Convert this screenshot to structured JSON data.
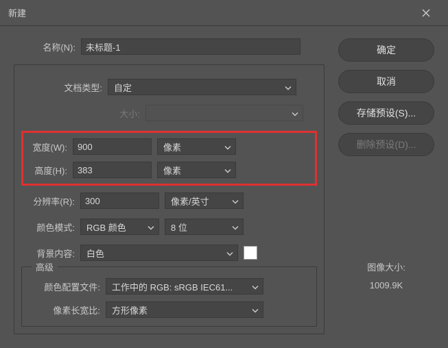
{
  "title": "新建",
  "name_label": "名称(N):",
  "name_value": "未标题-1",
  "doc_type_label": "文档类型:",
  "doc_type_value": "自定",
  "size_label": "大小:",
  "width_label": "宽度(W):",
  "width_value": "900",
  "width_unit": "像素",
  "height_label": "高度(H):",
  "height_value": "383",
  "height_unit": "像素",
  "resolution_label": "分辨率(R):",
  "resolution_value": "300",
  "resolution_unit": "像素/英寸",
  "color_mode_label": "颜色模式:",
  "color_mode_value": "RGB 颜色",
  "bit_depth": "8 位",
  "bg_label": "背景内容:",
  "bg_value": "白色",
  "bg_color": "#ffffff",
  "advanced_legend": "高级",
  "profile_label": "颜色配置文件:",
  "profile_value": "工作中的 RGB: sRGB IEC61...",
  "aspect_label": "像素长宽比:",
  "aspect_value": "方形像素",
  "btn_ok": "确定",
  "btn_cancel": "取消",
  "btn_save_preset": "存储预设(S)...",
  "btn_delete_preset": "删除预设(D)...",
  "image_size_label": "图像大小:",
  "image_size_value": "1009.9K"
}
